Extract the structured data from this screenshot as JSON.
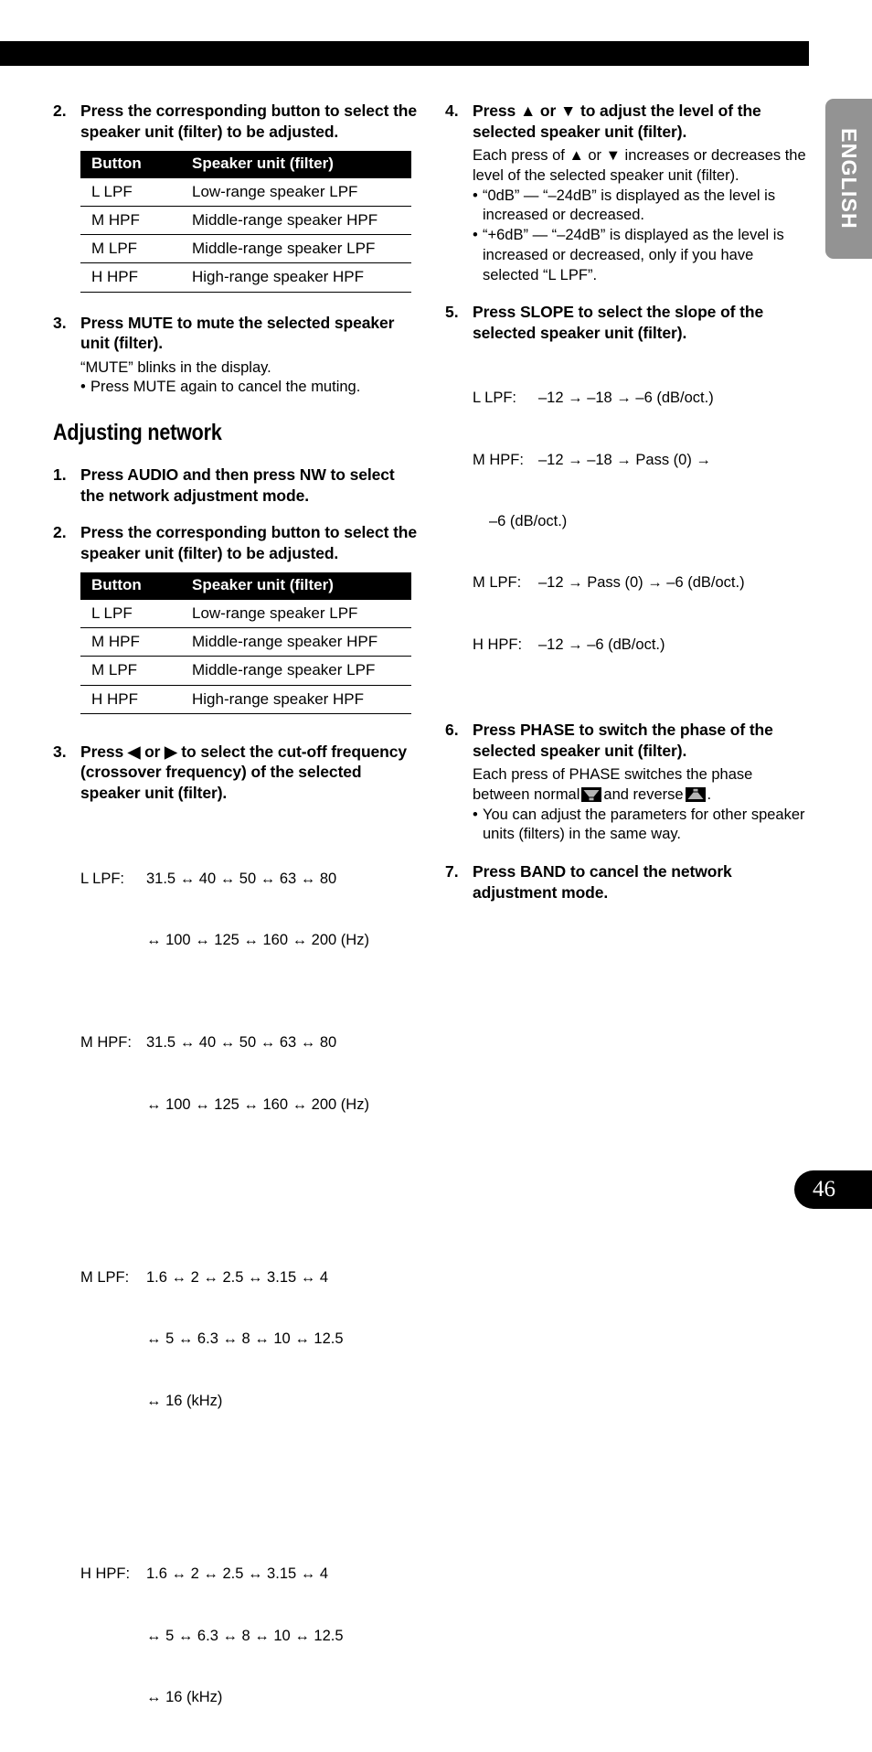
{
  "page": {
    "number": "46",
    "language_tab": "ENGLISH"
  },
  "left_column": {
    "step2": {
      "num": "2.",
      "title": "Press the corresponding button to select the speaker unit (filter) to be adjusted.",
      "table": {
        "headers": [
          "Button",
          "Speaker unit (filter)"
        ],
        "rows": [
          [
            "L LPF",
            "Low-range speaker LPF"
          ],
          [
            "M HPF",
            "Middle-range speaker HPF"
          ],
          [
            "M LPF",
            "Middle-range speaker LPF"
          ],
          [
            "H HPF",
            "High-range speaker HPF"
          ]
        ]
      }
    },
    "step3": {
      "num": "3.",
      "title": "Press MUTE to mute the selected speaker unit (filter).",
      "sub": "“MUTE” blinks in the display.",
      "bullet": "Press MUTE again to cancel the muting.",
      "bullet_dot": "•"
    },
    "heading": "Adjusting network",
    "nw_step1": {
      "num": "1.",
      "title": "Press AUDIO and then press NW to select the network adjustment mode."
    },
    "nw_step2": {
      "num": "2.",
      "title": "Press the corresponding button to select the speaker unit (filter) to be adjusted.",
      "table": {
        "headers": [
          "Button",
          "Speaker unit (filter)"
        ],
        "rows": [
          [
            "L LPF",
            "Low-range speaker LPF"
          ],
          [
            "M HPF",
            "Middle-range speaker HPF"
          ],
          [
            "M LPF",
            "Middle-range speaker LPF"
          ],
          [
            "H HPF",
            "High-range speaker HPF"
          ]
        ]
      }
    },
    "nw_step3": {
      "num": "3.",
      "title": "Press ◀ or ▶ to select the cut-off frequency (crossover frequency) of the selected speaker unit (filter).",
      "freq": [
        {
          "label": "L LPF:",
          "line1": "31.5 ↔ 40 ↔ 50 ↔ 63 ↔ 80",
          "line2": "↔ 100 ↔ 125 ↔ 160 ↔ 200 (Hz)"
        },
        {
          "label": "M HPF:",
          "line1": "31.5 ↔ 40 ↔ 50 ↔ 63 ↔ 80",
          "line2": "↔ 100 ↔ 125 ↔ 160 ↔ 200 (Hz)"
        },
        {
          "label": "M LPF:",
          "line1": "1.6 ↔ 2 ↔ 2.5 ↔ 3.15 ↔ 4",
          "line2": "↔ 5 ↔ 6.3 ↔ 8 ↔ 10 ↔ 12.5",
          "line3": "↔ 16 (kHz)"
        },
        {
          "label": "H HPF:",
          "line1": "1.6 ↔ 2 ↔ 2.5 ↔ 3.15 ↔ 4",
          "line2": "↔ 5 ↔ 6.3 ↔ 8 ↔ 10 ↔ 12.5",
          "line3": "↔ 16 (kHz)"
        }
      ]
    }
  },
  "right_column": {
    "step4": {
      "num": "4.",
      "title": "Press ▲ or ▼ to adjust the level of the selected speaker unit (filter).",
      "sub": "Each press of ▲ or ▼ increases or decreases the level of the selected speaker unit (filter).",
      "bullets": [
        "“0dB” — “–24dB” is displayed as the level is increased or decreased.",
        "“+6dB” — “–24dB” is displayed as the level is increased or decreased, only if you have selected “L LPF”."
      ],
      "bullet_dot": "•"
    },
    "step5": {
      "num": "5.",
      "title": "Press SLOPE to select the slope of the selected speaker unit (filter).",
      "slope": [
        {
          "label": "L LPF:",
          "line1": "–12 → –18 → –6 (dB/oct.)"
        },
        {
          "label": "M HPF:",
          "line1": "–12 → –18 → Pass (0) →",
          "line2": "–6 (dB/oct.)"
        },
        {
          "label": "M LPF:",
          "line1": "–12 → Pass (0) → –6 (dB/oct.)"
        },
        {
          "label": "H HPF:",
          "line1": "–12 → –6 (dB/oct.)"
        }
      ]
    },
    "step6": {
      "num": "6.",
      "title": "Press PHASE to switch the phase of the selected speaker unit (filter).",
      "sub_part1": "Each press of PHASE switches the phase between normal",
      "sub_part2": "and reverse",
      "sub_part3": ".",
      "bullet": "You can adjust the parameters for other speaker units (filters) in the same way.",
      "bullet_dot": "•"
    },
    "step7": {
      "num": "7.",
      "title": "Press BAND to cancel the network adjustment mode."
    }
  }
}
